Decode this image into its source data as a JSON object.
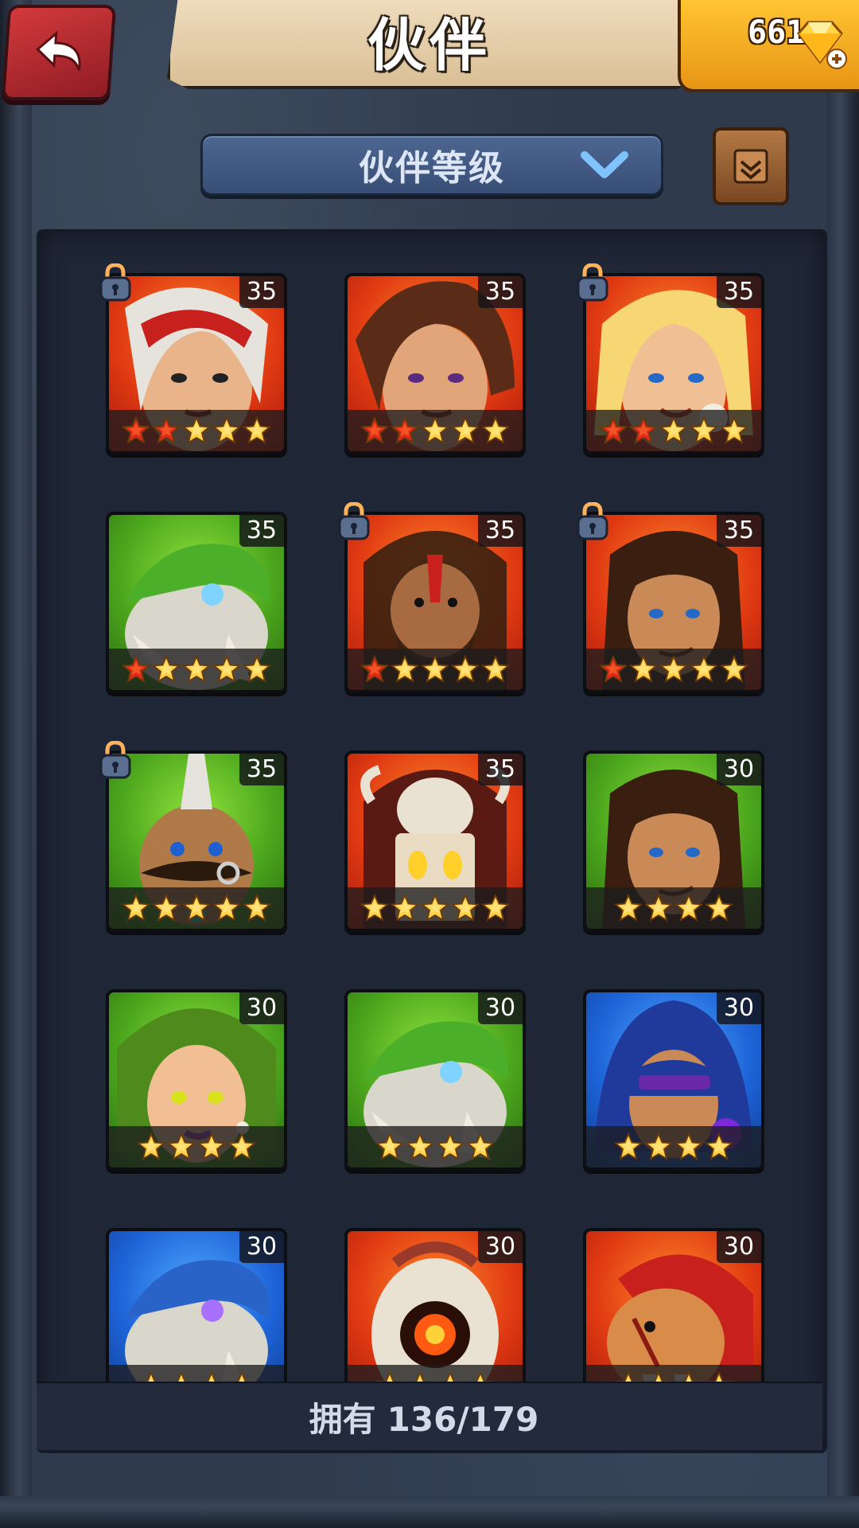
{
  "header": {
    "title": "伙伴",
    "gems": "661",
    "back_icon": "back-arrow-icon",
    "gem_icon": "gem-plus-icon"
  },
  "sort": {
    "label": "伙伴等级",
    "icon": "chevron-down-icon"
  },
  "scroll_button": {
    "icon": "scroll-icon"
  },
  "colors": {
    "red_card": "#e03a12",
    "green_card": "#4aa51c",
    "blue_card": "#1d63d8",
    "star_gold": "#ffd04a",
    "star_red": "#e3281c"
  },
  "partners": [
    {
      "level": "35",
      "bg": "red",
      "stars": 5,
      "red_stars": 2,
      "locked": true,
      "portrait": "white-haired-woman"
    },
    {
      "level": "35",
      "bg": "red",
      "stars": 5,
      "red_stars": 2,
      "locked": false,
      "portrait": "brown-haired-woman"
    },
    {
      "level": "35",
      "bg": "red",
      "stars": 5,
      "red_stars": 2,
      "locked": true,
      "portrait": "blonde-woman"
    },
    {
      "level": "35",
      "bg": "green",
      "stars": 5,
      "red_stars": 1,
      "locked": false,
      "portrait": "green-shell-beast"
    },
    {
      "level": "35",
      "bg": "red",
      "stars": 5,
      "red_stars": 1,
      "locked": true,
      "portrait": "bearded-barbarian"
    },
    {
      "level": "35",
      "bg": "red",
      "stars": 5,
      "red_stars": 1,
      "locked": true,
      "portrait": "long-haired-man"
    },
    {
      "level": "35",
      "bg": "green",
      "stars": 5,
      "red_stars": 0,
      "locked": true,
      "portrait": "mohawk-orc"
    },
    {
      "level": "35",
      "bg": "red",
      "stars": 5,
      "red_stars": 0,
      "locked": false,
      "portrait": "skull-mask-warrior"
    },
    {
      "level": "30",
      "bg": "green",
      "stars": 4,
      "red_stars": 0,
      "locked": false,
      "portrait": "long-haired-man"
    },
    {
      "level": "30",
      "bg": "green",
      "stars": 4,
      "red_stars": 0,
      "locked": false,
      "portrait": "green-haired-woman"
    },
    {
      "level": "30",
      "bg": "green",
      "stars": 4,
      "red_stars": 0,
      "locked": false,
      "portrait": "green-shell-beast"
    },
    {
      "level": "30",
      "bg": "blue",
      "stars": 4,
      "red_stars": 0,
      "locked": false,
      "portrait": "hooded-assassin"
    },
    {
      "level": "30",
      "bg": "blue",
      "stars": 4,
      "red_stars": 0,
      "locked": false,
      "portrait": "blue-shell-beast"
    },
    {
      "level": "30",
      "bg": "red",
      "stars": 4,
      "red_stars": 0,
      "locked": false,
      "portrait": "hooded-ghost"
    },
    {
      "level": "30",
      "bg": "red",
      "stars": 4,
      "red_stars": 0,
      "locked": false,
      "portrait": "scarred-lion"
    }
  ],
  "footer": {
    "owned_label": "拥有",
    "owned_count": "136/179"
  }
}
